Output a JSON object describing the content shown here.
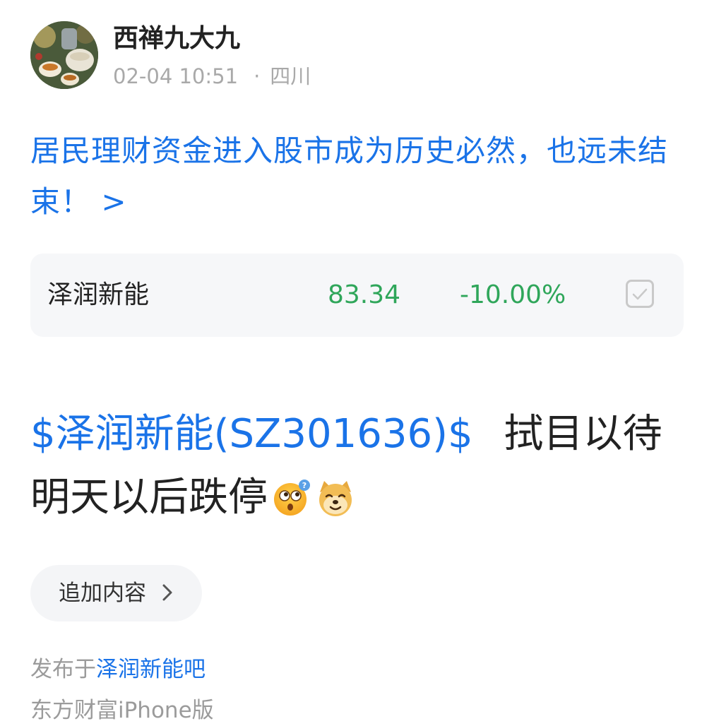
{
  "post": {
    "author": "西禅九大九",
    "date": "02-04 10:51",
    "separator": "·",
    "location": "四川",
    "headline": "居民理财资金进入股市成为历史必然，也远未结束！ >",
    "stock_card": {
      "name": "泽润新能",
      "price": "83.34",
      "change": "-10.00%",
      "checkbox_icon": "check-icon"
    },
    "body": {
      "stock_tag": "$泽润新能(SZ301636)$",
      "text": "拭目以待明天以后跌停",
      "emojis": [
        "thinking-face-emoji",
        "doge-emoji"
      ]
    },
    "append_button_label": "追加内容",
    "append_icon": "chevron-right-icon",
    "published_prefix": "发布于",
    "forum_name": "泽润新能吧",
    "client": "东方财富iPhone版"
  },
  "colors": {
    "link_blue": "#1a73e8",
    "price_down_green": "#2fa65a",
    "meta_gray": "#a9a9a9",
    "card_bg": "#f6f7f9"
  }
}
